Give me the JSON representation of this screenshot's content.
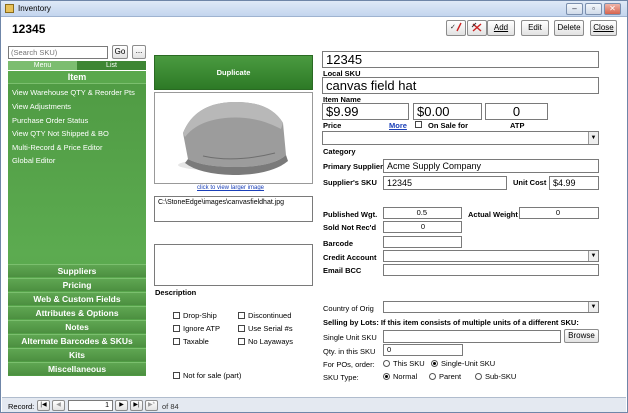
{
  "window": {
    "title": "Inventory",
    "minimize": "–",
    "restore": "▫",
    "close": "✕"
  },
  "header": {
    "sku": "12345"
  },
  "toolbar": {
    "add": "Add",
    "edit": "Edit",
    "delete": "Delete",
    "close": "Close"
  },
  "search": {
    "placeholder": "(Search SKU)",
    "go": "Go",
    "more": "..."
  },
  "tabs": {
    "menu": "Menu",
    "list": "List"
  },
  "sidebar": {
    "item_header": "Item",
    "links": [
      "View Warehouse QTY & Reorder Pts",
      "View Adjustments",
      "Purchase Order Status",
      "View QTY Not Shipped & BO",
      "Multi-Record & Price Editor",
      "Global Editor"
    ],
    "sections": [
      "Suppliers",
      "Pricing",
      "Web & Custom Fields",
      "Attributes & Options",
      "Notes",
      "Alternate Barcodes & SKUs",
      "Kits",
      "Miscellaneous"
    ]
  },
  "image": {
    "duplicate": "Duplicate",
    "larger_link": "click to view larger image",
    "path": "C:\\StoneEdge\\images\\canvasfieldhat.jpg"
  },
  "description": {
    "label": "Description"
  },
  "flags": {
    "drop_ship": "Drop-Ship",
    "discontinued": "Discontinued",
    "ignore_atp": "Ignore ATP",
    "use_serial": "Use Serial #s",
    "taxable": "Taxable",
    "no_layaways": "No Layaways",
    "not_for_sale": "Not for sale (part)"
  },
  "fields": {
    "local_sku_value": "12345",
    "local_sku_label": "Local SKU",
    "item_name_value": "canvas field hat",
    "item_name_label": "Item Name",
    "price_value": "$9.99",
    "price_label": "Price",
    "more_link": "More",
    "sale_value": "$0.00",
    "on_sale_label": "On Sale for",
    "atp_value": "0",
    "atp_label": "ATP",
    "category_label": "Category",
    "primary_supplier_label": "Primary Supplier",
    "primary_supplier_value": "Acme Supply Company",
    "supplier_sku_label": "Supplier's SKU",
    "supplier_sku_value": "12345",
    "unit_cost_label": "Unit Cost",
    "unit_cost_value": "$4.99",
    "published_wgt_label": "Published Wgt.",
    "published_wgt_value": "0.5",
    "actual_weight_label": "Actual Weight",
    "actual_weight_value": "0",
    "sold_not_recd_label": "Sold Not Rec'd",
    "sold_not_recd_value": "0",
    "barcode_label": "Barcode",
    "credit_account_label": "Credit Account",
    "email_bcc_label": "Email BCC",
    "country_label": "Country of Orig",
    "lots_header": "Selling by Lots: If this item consists of multiple units of a different SKU:",
    "single_unit_label": "Single Unit SKU",
    "browse": "Browse",
    "qty_label": "Qty. in this SKU",
    "qty_value": "0",
    "for_pos_label": "For POs, order:",
    "po_this": "This SKU",
    "po_single": "Single-Unit SKU",
    "sku_type_label": "SKU Type:",
    "type_normal": "Normal",
    "type_parent": "Parent",
    "type_sub": "Sub-SKU"
  },
  "record_nav": {
    "label": "Record:",
    "current": "1",
    "of": "of 84"
  },
  "colors": {
    "menu_green": "#4f9a43",
    "title_blue": "#c3d5ee",
    "link_blue": "#1a3fb8"
  }
}
